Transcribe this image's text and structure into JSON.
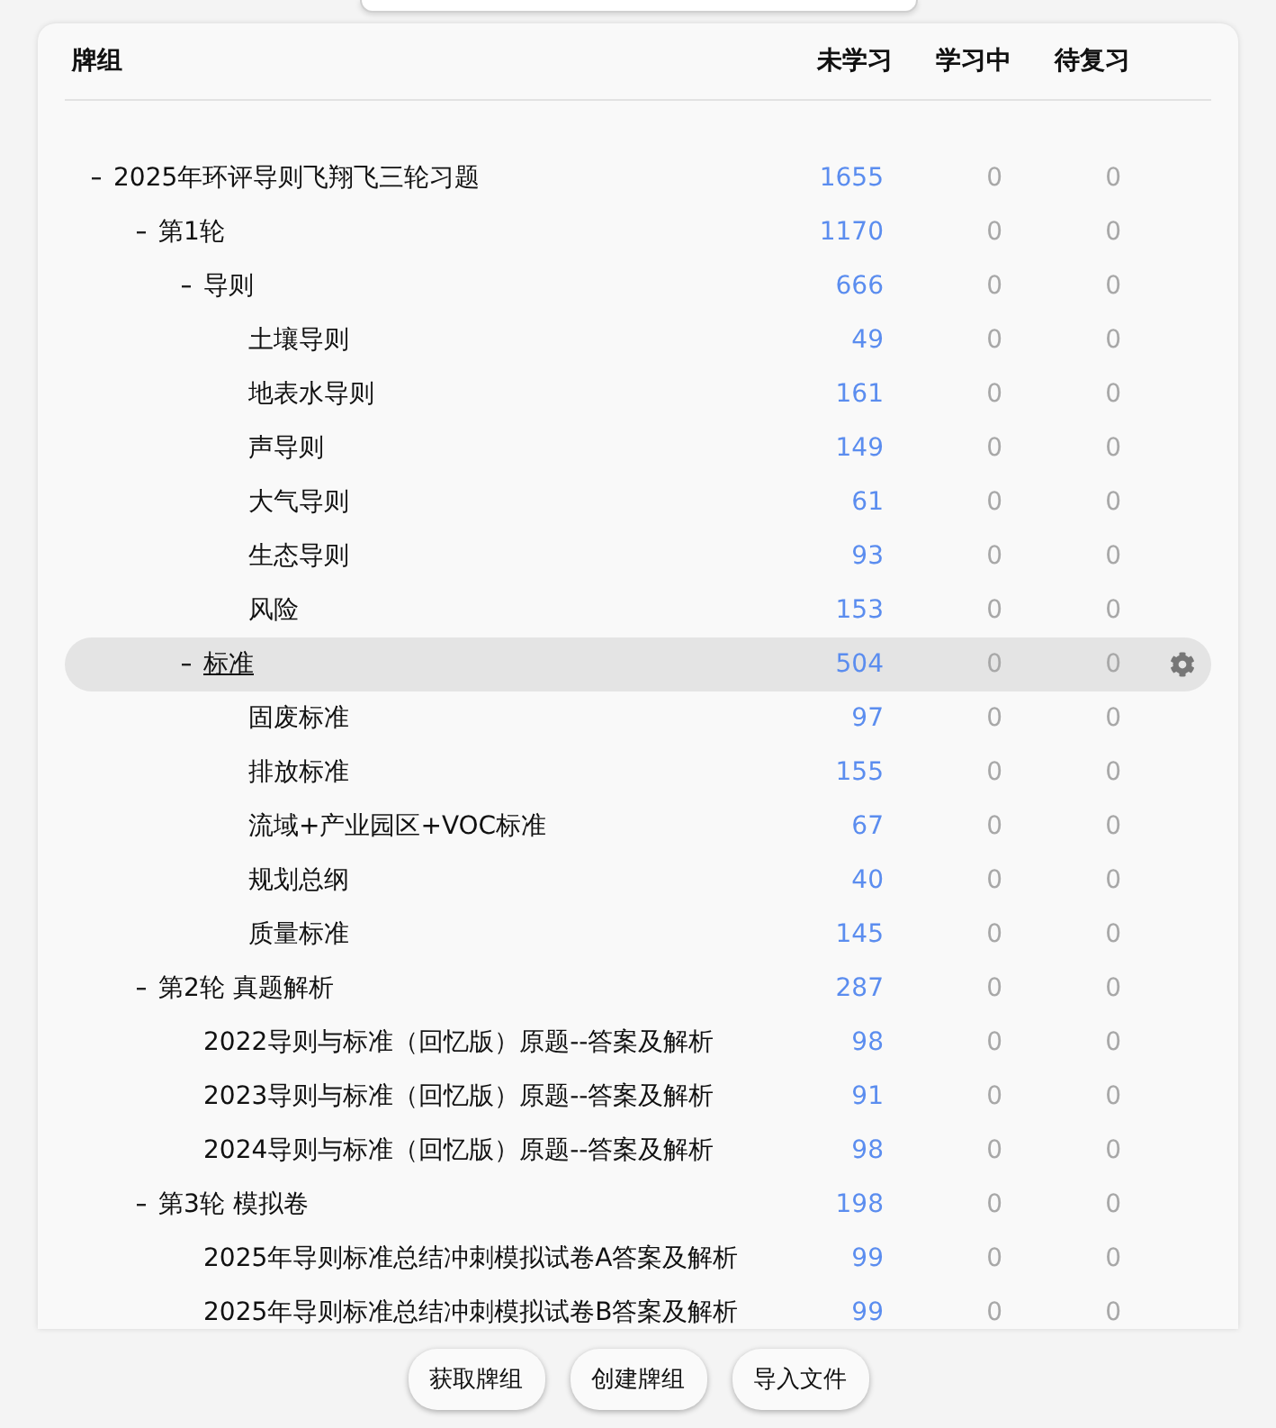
{
  "deck_table": {
    "columns": [
      "牌组",
      "未学习",
      "学习中",
      "待复习"
    ],
    "decks": [
      {
        "name": "2025年环评导则飞翔飞三轮习题",
        "new": "1655",
        "learning": "0",
        "review": "0",
        "expanded": true,
        "current": false,
        "children": [
          {
            "name": "第1轮",
            "new": "1170",
            "learning": "0",
            "review": "0",
            "expanded": true,
            "current": false,
            "children": [
              {
                "name": "导则",
                "new": "666",
                "learning": "0",
                "review": "0",
                "expanded": true,
                "current": false,
                "children": [
                  {
                    "name": "土壤导则",
                    "new": "49",
                    "learning": "0",
                    "review": "0",
                    "current": false
                  },
                  {
                    "name": "地表水导则",
                    "new": "161",
                    "learning": "0",
                    "review": "0",
                    "current": false
                  },
                  {
                    "name": "声导则",
                    "new": "149",
                    "learning": "0",
                    "review": "0",
                    "current": false
                  },
                  {
                    "name": "大气导则",
                    "new": "61",
                    "learning": "0",
                    "review": "0",
                    "current": false
                  },
                  {
                    "name": "生态导则",
                    "new": "93",
                    "learning": "0",
                    "review": "0",
                    "current": false
                  },
                  {
                    "name": "风险",
                    "new": "153",
                    "learning": "0",
                    "review": "0",
                    "current": false
                  }
                ]
              },
              {
                "name": "标准",
                "new": "504",
                "learning": "0",
                "review": "0",
                "expanded": true,
                "current": true,
                "children": [
                  {
                    "name": "固废标准",
                    "new": "97",
                    "learning": "0",
                    "review": "0",
                    "current": false
                  },
                  {
                    "name": "排放标准",
                    "new": "155",
                    "learning": "0",
                    "review": "0",
                    "current": false
                  },
                  {
                    "name": "流域+产业园区+VOC标准",
                    "new": "67",
                    "learning": "0",
                    "review": "0",
                    "current": false
                  },
                  {
                    "name": "规划总纲",
                    "new": "40",
                    "learning": "0",
                    "review": "0",
                    "current": false
                  },
                  {
                    "name": "质量标准",
                    "new": "145",
                    "learning": "0",
                    "review": "0",
                    "current": false
                  }
                ]
              }
            ]
          },
          {
            "name": "第2轮 真题解析",
            "new": "287",
            "learning": "0",
            "review": "0",
            "expanded": true,
            "current": false,
            "children": [
              {
                "name": "2022导则与标准（回忆版）原题--答案及解析",
                "new": "98",
                "learning": "0",
                "review": "0",
                "current": false
              },
              {
                "name": "2023导则与标准（回忆版）原题--答案及解析",
                "new": "91",
                "learning": "0",
                "review": "0",
                "current": false
              },
              {
                "name": "2024导则与标准（回忆版）原题--答案及解析",
                "new": "98",
                "learning": "0",
                "review": "0",
                "current": false
              }
            ]
          },
          {
            "name": "第3轮 模拟卷",
            "new": "198",
            "learning": "0",
            "review": "0",
            "expanded": true,
            "current": false,
            "children": [
              {
                "name": "2025年导则标准总结冲刺模拟试卷A答案及解析",
                "new": "99",
                "learning": "0",
                "review": "0",
                "current": false
              },
              {
                "name": "2025年导则标准总结冲刺模拟试卷B答案及解析",
                "new": "99",
                "learning": "0",
                "review": "0",
                "current": false
              }
            ]
          }
        ]
      }
    ]
  },
  "footer_buttons": [
    "获取牌组",
    "创建牌组",
    "导入文件"
  ]
}
